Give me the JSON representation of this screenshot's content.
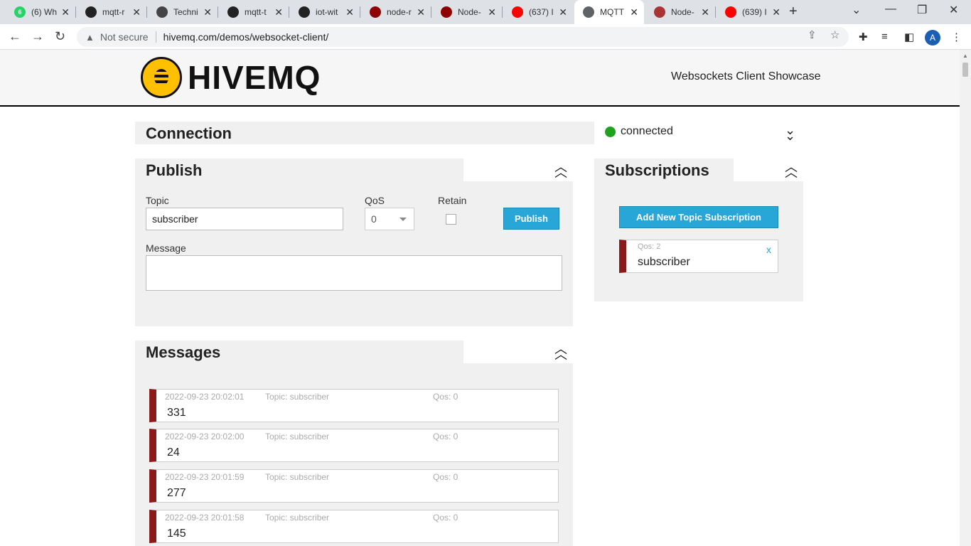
{
  "browser": {
    "tabs": [
      {
        "title": "(6) Wh",
        "favicon_color": "#25d366",
        "favicon_text": "6",
        "active": false
      },
      {
        "title": "mqtt-r",
        "favicon_color": "#222222",
        "favicon_text": "",
        "active": false
      },
      {
        "title": "Techni",
        "favicon_color": "#444444",
        "favicon_text": "",
        "active": false
      },
      {
        "title": "mqtt-t",
        "favicon_color": "#222222",
        "favicon_text": "",
        "active": false
      },
      {
        "title": "iot-wit",
        "favicon_color": "#222222",
        "favicon_text": "",
        "active": false
      },
      {
        "title": "node-r",
        "favicon_color": "#8f0000",
        "favicon_text": "",
        "active": false
      },
      {
        "title": "Node-",
        "favicon_color": "#8f0000",
        "favicon_text": "",
        "active": false
      },
      {
        "title": "(637) I",
        "favicon_color": "#ff0000",
        "favicon_text": "",
        "active": false
      },
      {
        "title": "MQTT",
        "favicon_color": "#5f6368",
        "favicon_text": "",
        "active": true
      },
      {
        "title": "Node-",
        "favicon_color": "#aa3333",
        "favicon_text": "",
        "active": false
      },
      {
        "title": "(639) I",
        "favicon_color": "#ff0000",
        "favicon_text": "",
        "active": false
      }
    ],
    "security_label": "Not secure",
    "url": "hivemq.com/demos/websocket-client/",
    "profile_initial": "A"
  },
  "header": {
    "logo_text": "HIVEMQ",
    "showcase_title": "Websockets Client Showcase"
  },
  "connection": {
    "title": "Connection",
    "status": "connected",
    "status_color": "#1fa31f"
  },
  "publish": {
    "title": "Publish",
    "topic_label": "Topic",
    "topic_value": "subscriber",
    "qos_label": "QoS",
    "qos_value": "0",
    "retain_label": "Retain",
    "button_label": "Publish",
    "message_label": "Message",
    "message_value": ""
  },
  "subscriptions": {
    "title": "Subscriptions",
    "add_button_label": "Add New Topic Subscription",
    "items": [
      {
        "qos": "Qos: 2",
        "topic": "subscriber",
        "remove": "x",
        "color": "#8b1a1a"
      }
    ]
  },
  "messages": {
    "title": "Messages",
    "items": [
      {
        "timestamp": "2022-09-23 20:02:01",
        "topic": "Topic: subscriber",
        "qos": "Qos: 0",
        "value": "331"
      },
      {
        "timestamp": "2022-09-23 20:02:00",
        "topic": "Topic: subscriber",
        "qos": "Qos: 0",
        "value": "24"
      },
      {
        "timestamp": "2022-09-23 20:01:59",
        "topic": "Topic: subscriber",
        "qos": "Qos: 0",
        "value": "277"
      },
      {
        "timestamp": "2022-09-23 20:01:58",
        "topic": "Topic: subscriber",
        "qos": "Qos: 0",
        "value": "145"
      }
    ]
  },
  "colors": {
    "accent": "#29a6d8",
    "panel": "#f0f0f0",
    "message_marker": "#8b1a1a"
  }
}
